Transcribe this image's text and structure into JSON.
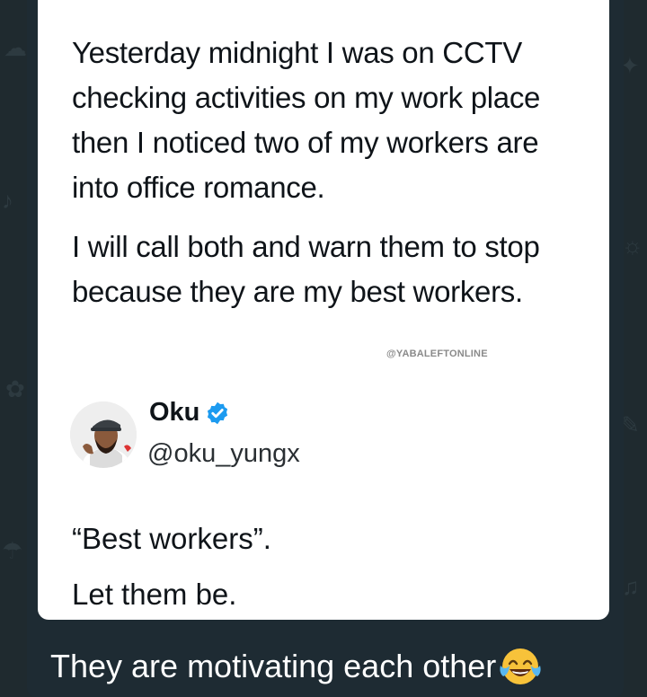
{
  "tweet": {
    "paragraph_1": "Yesterday midnight I was on CCTV checking activities on my work place then I noticed two of my workers are into office romance.",
    "paragraph_2": "I will call both and warn them to stop because they are my best workers.",
    "watermark": "@YABALEFTONLINE"
  },
  "reply_author": {
    "name": "Oku",
    "handle": "@oku_yungx",
    "verified_icon": "verified-badge-icon",
    "avatar_icon": "avatar-photo"
  },
  "reply": {
    "line_1": "“Best workers”.",
    "line_2": "Let them be."
  },
  "message": {
    "caption": "They are motivating each other",
    "emoji": "face-with-tears-of-joy-icon"
  },
  "colors": {
    "background": "#1f2a2f",
    "bubble": "#1e2b33",
    "card": "#ffffff",
    "verified_blue": "#1d9bf0"
  }
}
